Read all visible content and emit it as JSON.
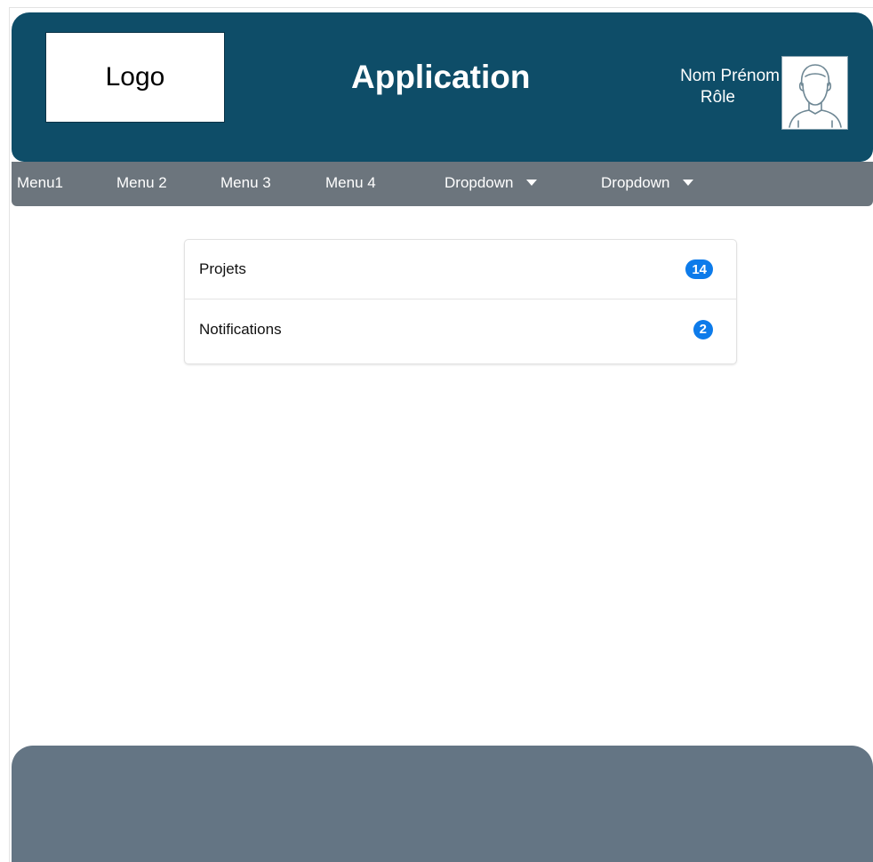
{
  "header": {
    "logo_text": "Logo",
    "app_title": "Application",
    "user_name": "Nom Prénom",
    "user_role": "Rôle",
    "bg_color": "#0e4d68",
    "avatar_icon": "user-avatar-icon"
  },
  "nav": {
    "items": [
      {
        "label": "Menu1"
      },
      {
        "label": "Menu 2"
      },
      {
        "label": "Menu 3"
      },
      {
        "label": "Menu 4"
      },
      {
        "label": "Dropdown"
      },
      {
        "label": "Dropdown"
      }
    ],
    "caret_icon": "caret-down-icon",
    "bg_color": "#6c757d"
  },
  "list": {
    "items": [
      {
        "label": "Projets",
        "count": "14"
      },
      {
        "label": "Notifications",
        "count": "2"
      }
    ],
    "badge_color": "#0d7bea"
  },
  "footer": {
    "bg_color": "#647584"
  }
}
